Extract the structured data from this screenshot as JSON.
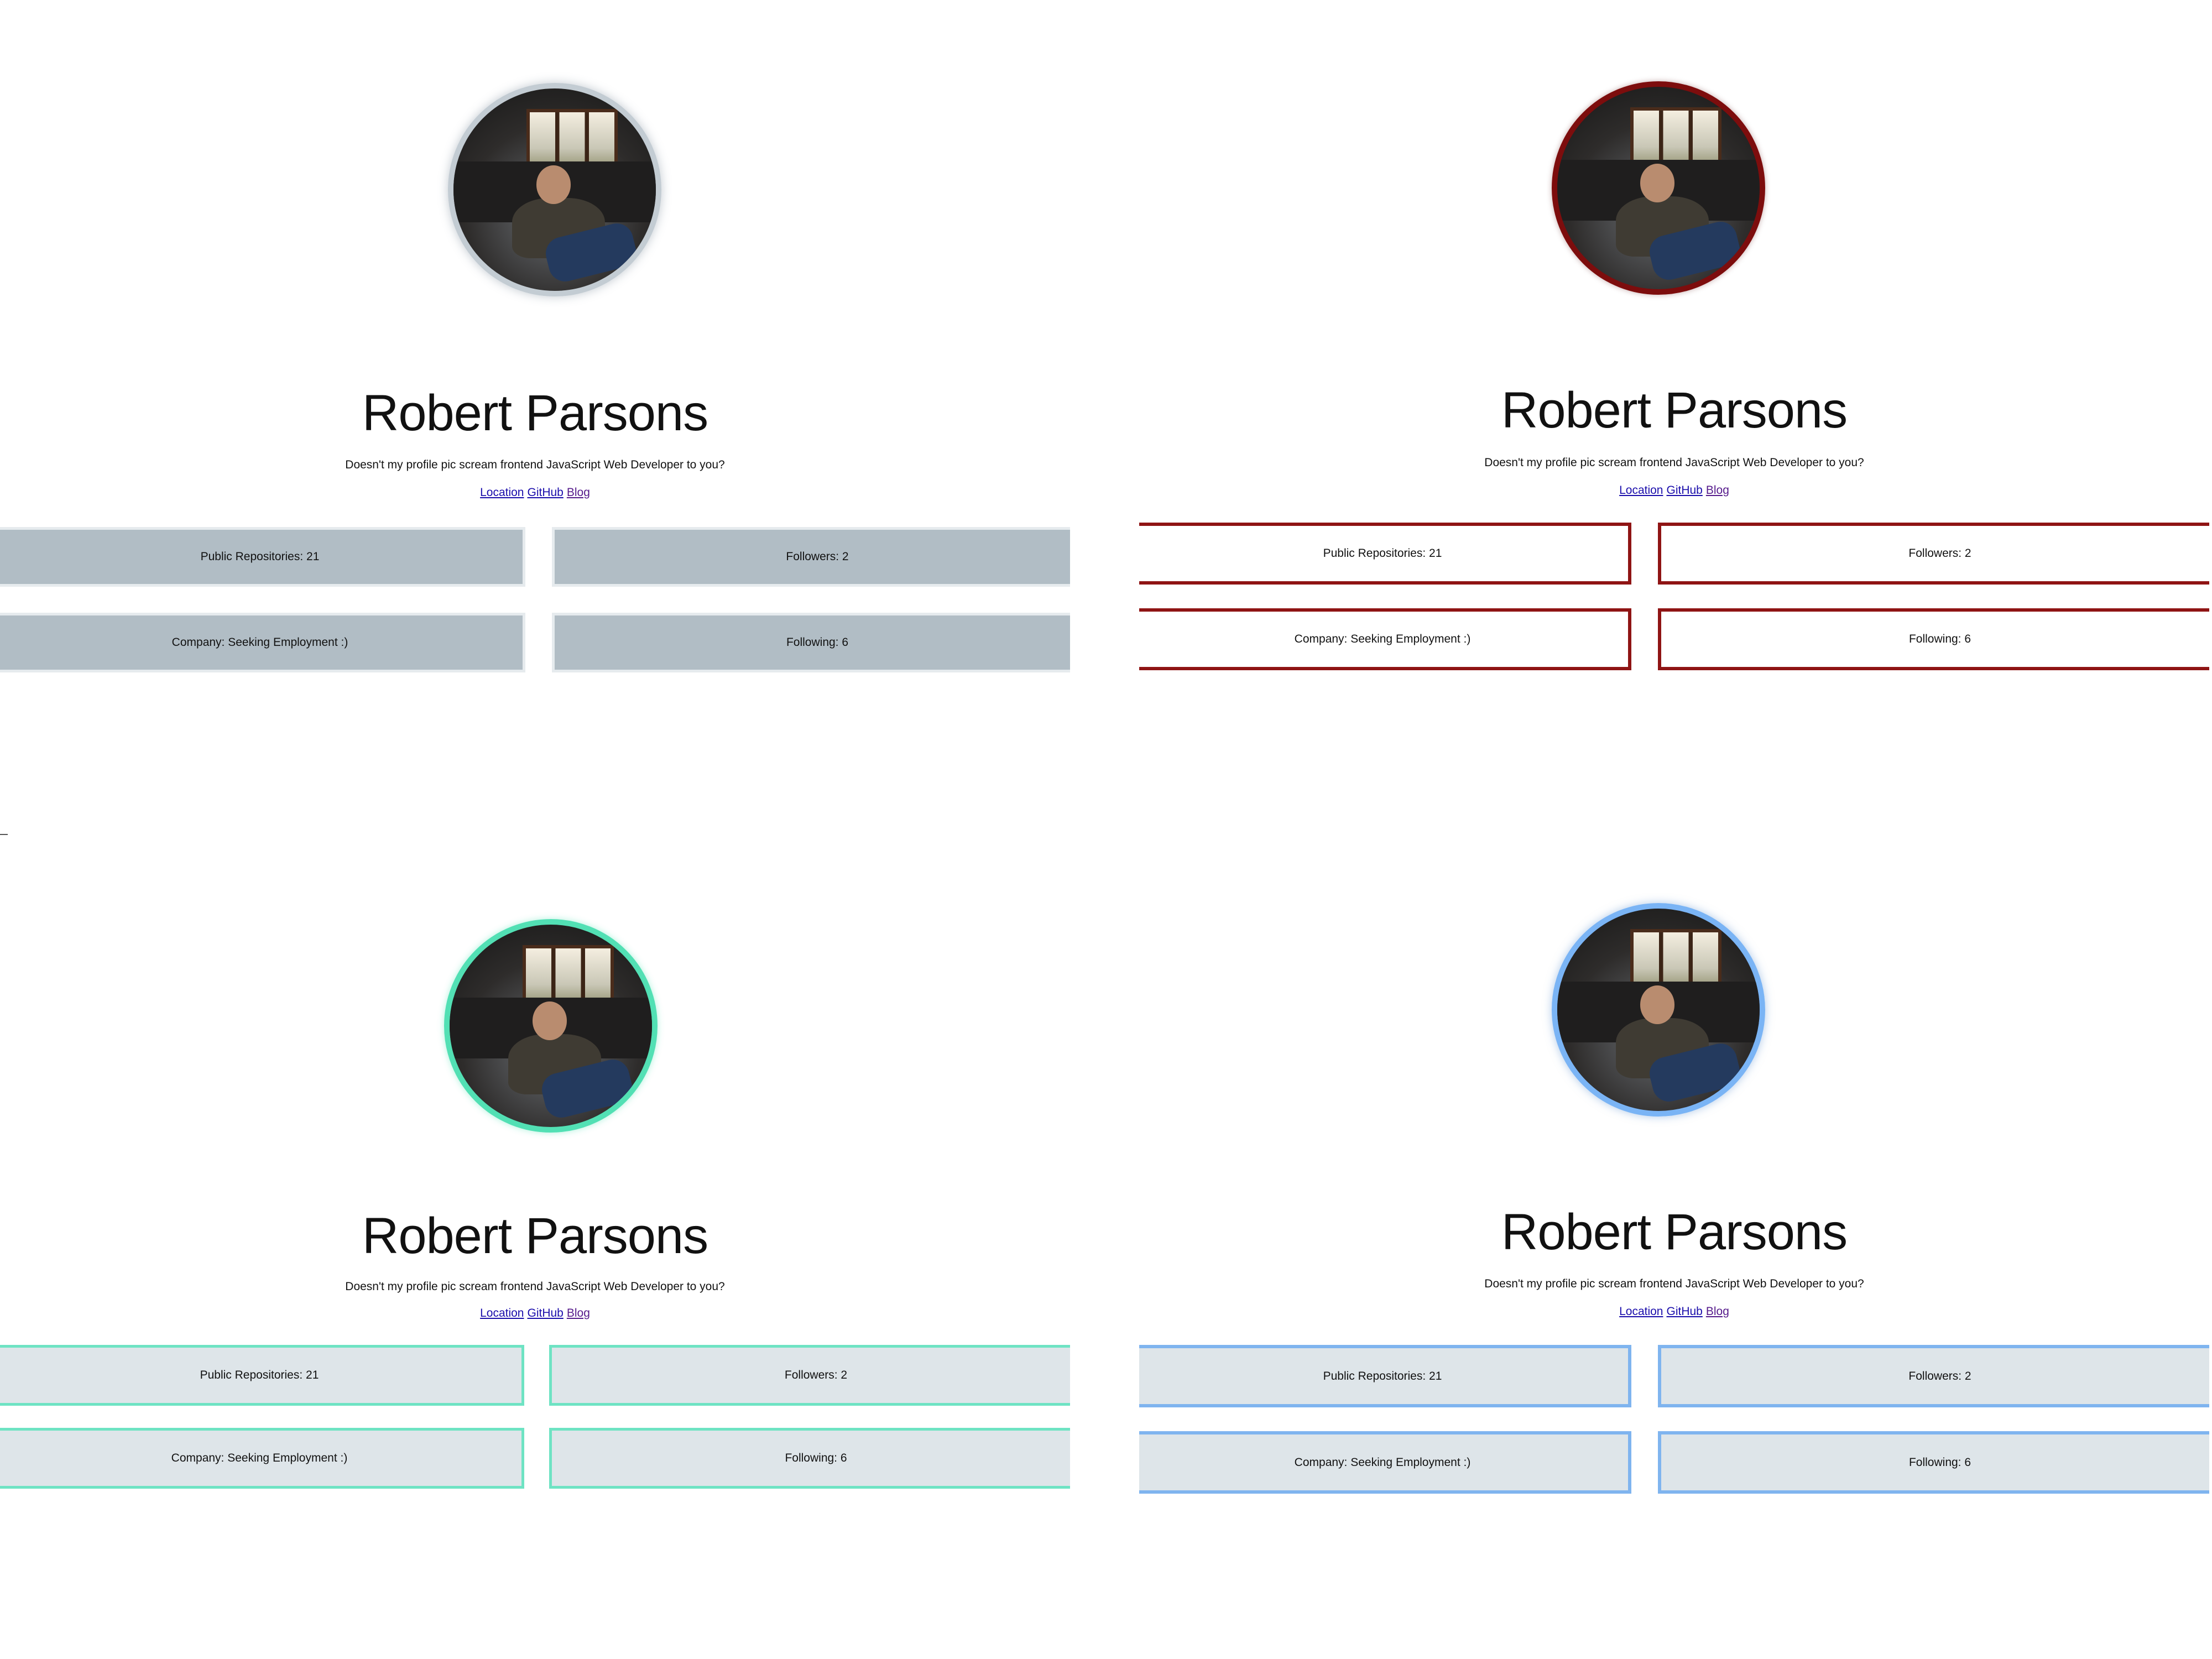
{
  "profile": {
    "name": "Robert Parsons",
    "bio": "Doesn't my profile pic scream frontend JavaScript Web Developer to you?",
    "links": [
      "Location",
      "GitHub",
      "Blog"
    ],
    "stats": {
      "public_repos": "Public Repositories: 21",
      "followers": "Followers: 2",
      "company": "Company: Seeking Employment :)",
      "following": "Following: 6"
    }
  },
  "themes": {
    "grey": {
      "border": "#c3ccd3",
      "card_bg": "#b1bdc5",
      "card_border": "#e6ebee"
    },
    "red": {
      "border": "#7d0d0d",
      "card_bg": "#ffffff",
      "card_border": "#8f1414"
    },
    "mint": {
      "border": "#52e0b4",
      "card_bg": "#dee5e9",
      "card_border": "#6ee3c3"
    },
    "blue": {
      "border": "#7ab4f5",
      "card_bg": "#dee5e9",
      "card_border": "#7fb4ef"
    }
  },
  "link_colors": {
    "unvisited": "#1a0dab",
    "visited": "#551a8b"
  }
}
